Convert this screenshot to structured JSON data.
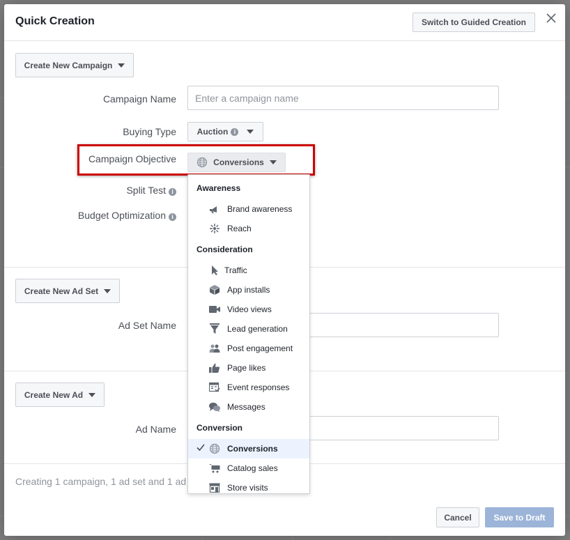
{
  "modal": {
    "title": "Quick Creation",
    "switch_label": "Switch to Guided Creation"
  },
  "campaign": {
    "create_label": "Create New Campaign",
    "name_label": "Campaign Name",
    "name_placeholder": "Enter a campaign name",
    "buying_type_label": "Buying Type",
    "buying_type_value": "Auction",
    "objective_label": "Campaign Objective",
    "objective_value": "Conversions",
    "split_test_label": "Split Test",
    "budget_label": "Budget Optimization"
  },
  "adset": {
    "create_label": "Create New Ad Set",
    "name_label": "Ad Set Name"
  },
  "ad": {
    "create_label": "Create New Ad",
    "name_label": "Ad Name"
  },
  "footer": {
    "summary": "Creating 1 campaign, 1 ad set and 1 ad",
    "cancel_label": "Cancel",
    "save_label": "Save to Draft"
  },
  "dropdown": {
    "groups": [
      "Awareness",
      "Consideration",
      "Conversion"
    ],
    "items": [
      {
        "label": "Brand awareness",
        "icon": "megaphone-icon"
      },
      {
        "label": "Reach",
        "icon": "reach-icon"
      },
      {
        "label": "Traffic",
        "icon": "cursor-icon"
      },
      {
        "label": "App installs",
        "icon": "box-icon"
      },
      {
        "label": "Video views",
        "icon": "video-camera-icon"
      },
      {
        "label": "Lead generation",
        "icon": "funnel-icon"
      },
      {
        "label": "Post engagement",
        "icon": "people-icon"
      },
      {
        "label": "Page likes",
        "icon": "thumbs-up-icon"
      },
      {
        "label": "Event responses",
        "icon": "calendar-icon"
      },
      {
        "label": "Messages",
        "icon": "chat-bubbles-icon"
      },
      {
        "label": "Conversions",
        "icon": "globe-icon",
        "selected": true
      },
      {
        "label": "Catalog sales",
        "icon": "cart-icon"
      },
      {
        "label": "Store visits",
        "icon": "store-icon"
      }
    ]
  },
  "colors": {
    "highlight": "#cc0000",
    "save_disabled": "#9cb4d8",
    "selected_row": "#ecf3ff"
  }
}
